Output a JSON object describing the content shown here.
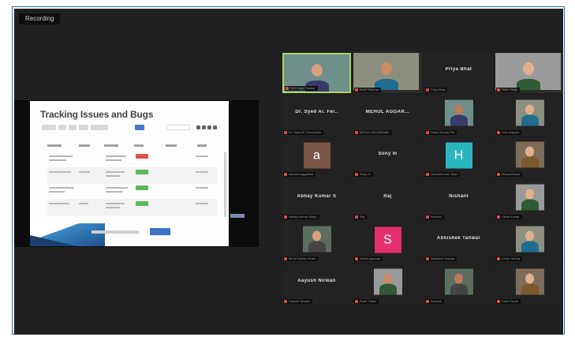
{
  "recording_label": "Recording",
  "shared_slide": {
    "title": "Tracking Issues and Bugs"
  },
  "participants": [
    {
      "name": "",
      "label": "Kirti Daga Tanwar",
      "kind": "video",
      "active": true
    },
    {
      "name": "",
      "label": "Ankit Sharma",
      "kind": "video"
    },
    {
      "name": "Priya Bhat",
      "label": "Priya Bhat",
      "kind": "name"
    },
    {
      "name": "",
      "label": "Nidhi Singh",
      "kind": "video"
    },
    {
      "name": "Dr. Syed Ai. Fer..",
      "label": "Dr. Syed Ai. Fernandes",
      "kind": "name"
    },
    {
      "name": "MEHUL AGGAR...",
      "label": "MEHUL AGGARWAL",
      "kind": "name"
    },
    {
      "name": "",
      "label": "Rahul Kumar Pal",
      "kind": "photo"
    },
    {
      "name": "",
      "label": "Arun Kapoor",
      "kind": "photo"
    },
    {
      "name": "",
      "label": "Aarushi Aggarwal",
      "kind": "letter",
      "letter": "a",
      "color": "#7b5646"
    },
    {
      "name": "Sony m",
      "label": "Sony m",
      "kind": "name"
    },
    {
      "name": "",
      "label": "Harshita Kaur Saini",
      "kind": "letter",
      "letter": "H",
      "color": "#2bb6bf"
    },
    {
      "name": "",
      "label": "Manoj Rawat",
      "kind": "photo"
    },
    {
      "name": "Abhay Kumar S",
      "label": "Abhay Kumar Singh",
      "kind": "name"
    },
    {
      "name": "Raj",
      "label": "Raj",
      "kind": "name"
    },
    {
      "name": "Nishant",
      "label": "Nishant",
      "kind": "name"
    },
    {
      "name": "",
      "label": "Vikas Kumar",
      "kind": "photo"
    },
    {
      "name": "",
      "label": "Mohd Danish Khan",
      "kind": "photo"
    },
    {
      "name": "",
      "label": "Shruti Agarwal",
      "kind": "letter",
      "letter": "S",
      "color": "#e5306f"
    },
    {
      "name": "Abhishek Tanwar",
      "label": "Abhishek Tanwar",
      "kind": "name"
    },
    {
      "name": "",
      "label": "Aman Verma",
      "kind": "photo"
    },
    {
      "name": "Aayush Nirwan",
      "label": "Aayush Nirwan",
      "kind": "name"
    },
    {
      "name": "",
      "label": "Rohit Yadav",
      "kind": "photo"
    },
    {
      "name": "",
      "label": "Deepak",
      "kind": "photo"
    },
    {
      "name": "",
      "label": "Sahil Gupta",
      "kind": "photo"
    }
  ],
  "colors": {
    "frame_border": "#2d6cb5",
    "meeting_bg": "#202020",
    "tile_bg": "#222222",
    "active_speaker": "#a8d66a",
    "mic_muted": "#e04b4b"
  }
}
